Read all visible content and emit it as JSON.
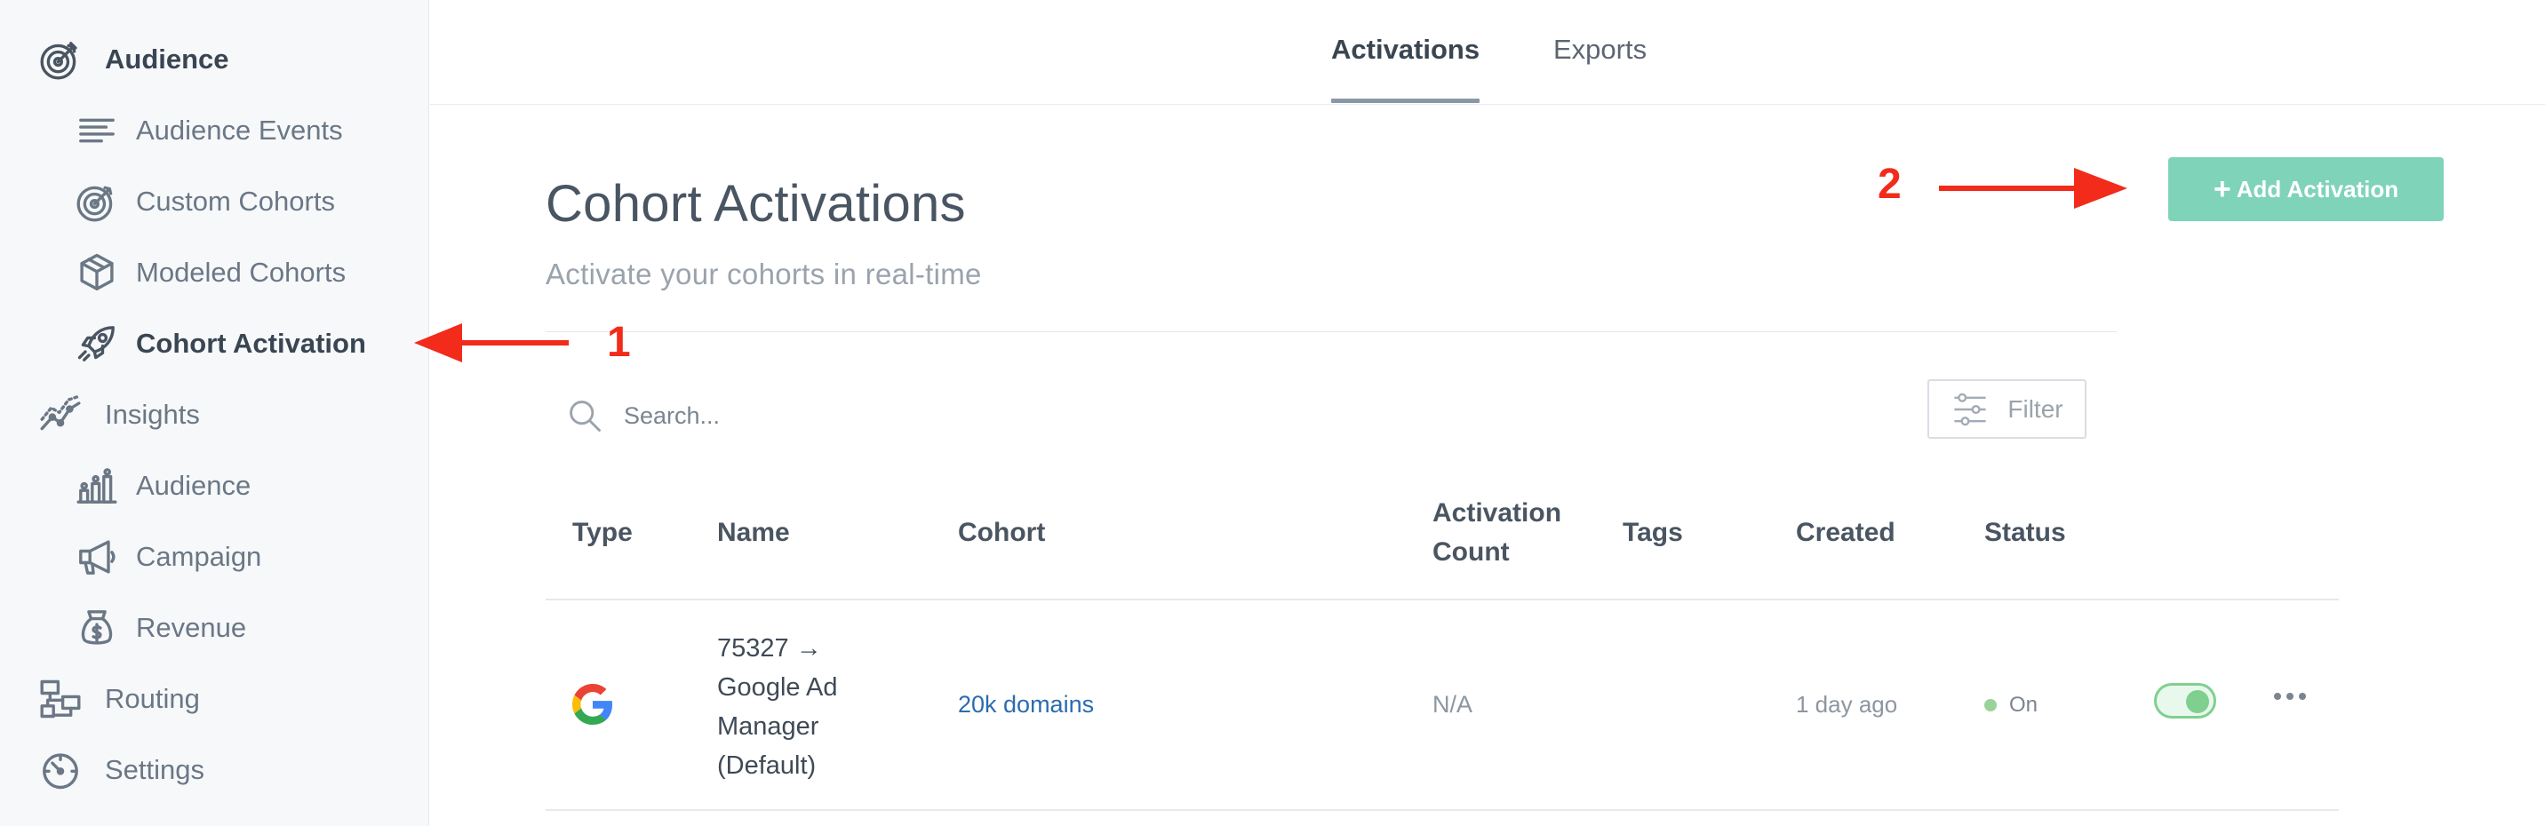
{
  "sidebar": {
    "items": [
      {
        "label": "Audience",
        "icon": "target-icon"
      },
      {
        "label": "Audience Events",
        "icon": "list-icon"
      },
      {
        "label": "Custom Cohorts",
        "icon": "target-icon"
      },
      {
        "label": "Modeled Cohorts",
        "icon": "cube-icon"
      },
      {
        "label": "Cohort Activation",
        "icon": "rocket-icon"
      },
      {
        "label": "Insights",
        "icon": "line-chart-icon"
      },
      {
        "label": "Audience",
        "icon": "bar-chart-people-icon"
      },
      {
        "label": "Campaign",
        "icon": "megaphone-icon"
      },
      {
        "label": "Revenue",
        "icon": "money-bag-icon"
      },
      {
        "label": "Routing",
        "icon": "routing-icon"
      },
      {
        "label": "Settings",
        "icon": "gauge-icon"
      }
    ]
  },
  "tabs": [
    {
      "label": "Activations",
      "active": true
    },
    {
      "label": "Exports",
      "active": false
    }
  ],
  "header": {
    "title": "Cohort Activations",
    "subtitle": "Activate your cohorts in real-time",
    "add_button": "Add Activation",
    "add_button_prefix": "+"
  },
  "search": {
    "placeholder": "Search..."
  },
  "filter": {
    "label": "Filter"
  },
  "table": {
    "columns": {
      "type": "Type",
      "name": "Name",
      "cohort": "Cohort",
      "activation_count_line1": "Activation",
      "activation_count_line2": "Count",
      "tags": "Tags",
      "created": "Created",
      "status": "Status"
    },
    "rows": [
      {
        "type_icon": "google-logo-icon",
        "name_lines": [
          "75327 →",
          "Google Ad",
          "Manager",
          "(Default)"
        ],
        "cohort": "20k domains",
        "activation_count": "N/A",
        "tags": "",
        "created": "1 day ago",
        "status": "On",
        "enabled": true
      }
    ]
  },
  "annotations": {
    "label_1": "1",
    "label_2": "2",
    "color": "#f22b1b"
  },
  "colors": {
    "accent": "#7fd3b8",
    "link": "#2b6cb0",
    "status_on": "#9ad39a"
  }
}
